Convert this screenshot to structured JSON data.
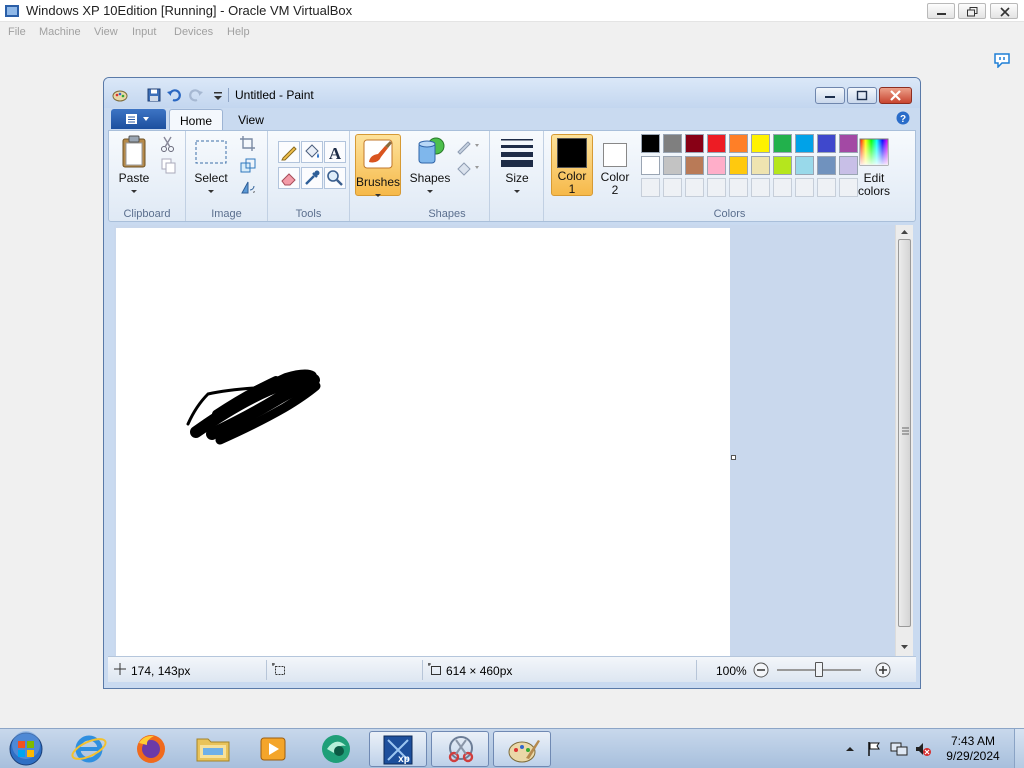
{
  "vbox": {
    "title": "Windows XP 10Edition [Running] - Oracle VM VirtualBox",
    "menu": [
      "File",
      "Machine",
      "View",
      "Input",
      "Devices",
      "Help"
    ]
  },
  "paint": {
    "title": "Untitled - Paint",
    "tabs": {
      "home": "Home",
      "view": "View"
    },
    "groups": {
      "clipboard": {
        "label": "Clipboard",
        "paste": "Paste"
      },
      "image": {
        "label": "Image",
        "select": "Select"
      },
      "tools": {
        "label": "Tools"
      },
      "brushes": {
        "label": "Brushes"
      },
      "shapes": {
        "label": "Shapes",
        "shapes_btn": "Shapes"
      },
      "size": {
        "label": "Size"
      },
      "colors": {
        "label": "Colors",
        "color1": "Color",
        "color1_num": "1",
        "color2": "Color",
        "color2_num": "2",
        "edit": "Edit",
        "edit2": "colors"
      }
    },
    "palette_row1": [
      "#000000",
      "#7f7f7f",
      "#880015",
      "#ed1c24",
      "#ff7f27",
      "#fff200",
      "#22b14c",
      "#00a2e8",
      "#3f48cc",
      "#a349a4"
    ],
    "palette_row2": [
      "#ffffff",
      "#c3c3c3",
      "#b97a57",
      "#ffaec9",
      "#ffc90e",
      "#efe4b0",
      "#b5e61d",
      "#99d9ea",
      "#7092be",
      "#c8bfe7"
    ],
    "color1_value": "#000000",
    "color2_value": "#ffffff",
    "status": {
      "cursor": "174, 143px",
      "image_size": "614 × 460px",
      "zoom": "100%"
    }
  },
  "taskbar": {
    "time": "7:43 AM",
    "date": "9/29/2024"
  }
}
